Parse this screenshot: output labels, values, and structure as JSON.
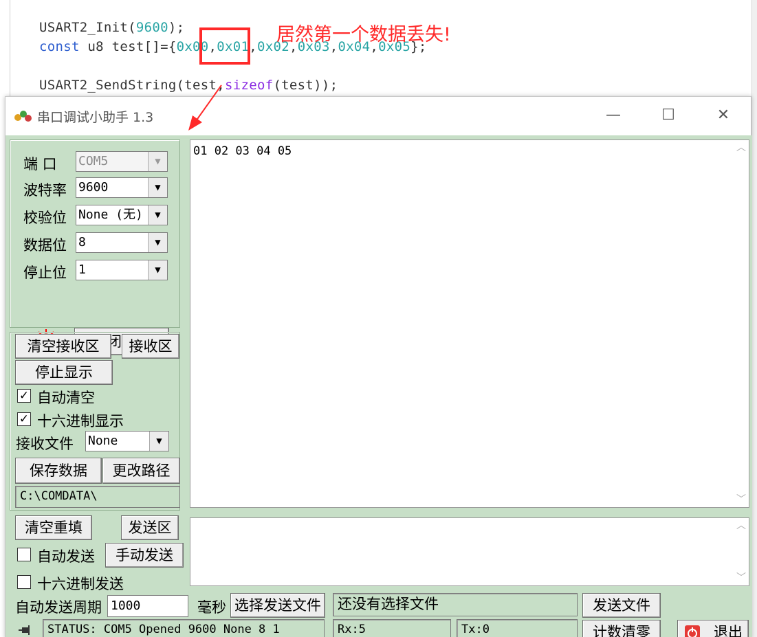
{
  "editor": {
    "line1": {
      "fn": "USART2_Init(",
      "arg": "9600",
      "tail": ");"
    },
    "line2": {
      "kw": "const",
      "decl": " u8 test[]={",
      "values": [
        "0x00",
        "0x01",
        "0x02",
        "0x03",
        "0x04",
        "0x05"
      ],
      "tail": "};"
    },
    "line3": {
      "fn": "USART2_SendString(test,",
      "kw": "sizeof",
      "tail": "(test));"
    },
    "annotation": "居然第一个数据丢失!"
  },
  "window": {
    "title": "串口调试小助手 1.3",
    "minimize": "—",
    "maximize": "☐",
    "close": "✕"
  },
  "port_settings": {
    "port_label": "端  口",
    "port_value": "COM5",
    "baud_label": "波特率",
    "baud_value": "9600",
    "parity_label": "校验位",
    "parity_value": "None (无)",
    "databits_label": "数据位",
    "databits_value": "8",
    "stopbits_label": "停止位",
    "stopbits_value": "1",
    "close_port_button": "关闭串口"
  },
  "receive": {
    "clear_button": "清空接收区",
    "area_button": "接收区",
    "stop_display_button": "停止显示",
    "auto_clear_label": "自动清空",
    "auto_clear_checked": true,
    "hex_display_label": "十六进制显示",
    "hex_display_checked": true,
    "file_label": "接收文件",
    "file_value": "None",
    "save_button": "保存数据",
    "change_path_button": "更改路径",
    "path": "C:\\COMDATA\\",
    "content": "01 02 03 04 05"
  },
  "send": {
    "clear_button": "清空重填",
    "area_button": "发送区",
    "auto_send_label": "自动发送",
    "auto_send_checked": false,
    "manual_send_button": "手动发送",
    "hex_send_label": "十六进制发送",
    "hex_send_checked": false,
    "period_label": "自动发送周期",
    "period_value": "1000",
    "ms_label": "毫秒",
    "choose_file_button": "选择发送文件",
    "file_status": "还没有选择文件",
    "send_file_button": "发送文件"
  },
  "status": {
    "text": "STATUS: COM5 Opened 9600 None  8 1",
    "rx": "Rx:5",
    "tx": "Tx:0",
    "clear_count_button": "计数清零",
    "exit_button": "退出"
  },
  "colors": {
    "panel": "#c7dfc7",
    "annotation": "#ff2a2a",
    "led": "#ff0000"
  }
}
